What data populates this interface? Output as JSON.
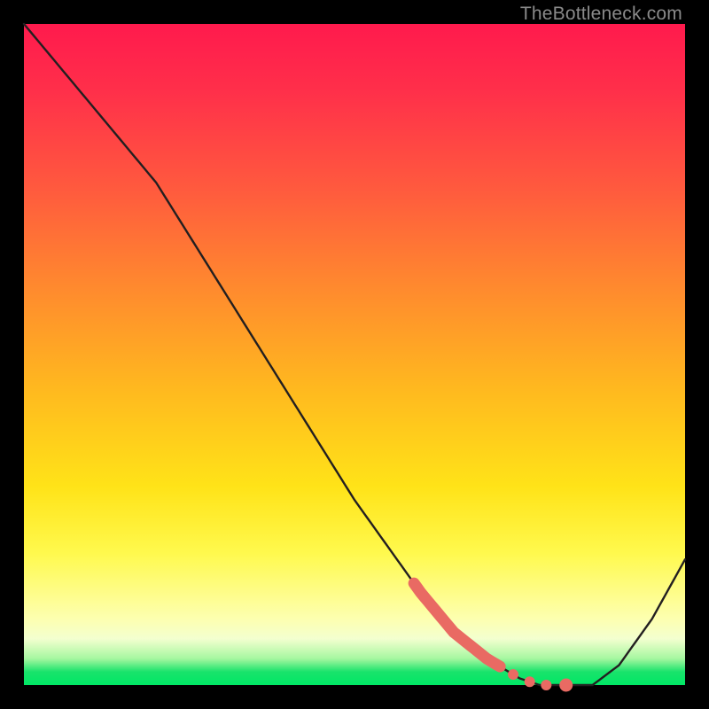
{
  "watermark": "TheBottleneck.com",
  "colors": {
    "background": "#000000",
    "curve": "#231f20",
    "highlight": "#e96a63",
    "gradient_top": "#ff1a4d",
    "gradient_bottom": "#00e765"
  },
  "chart_data": {
    "type": "line",
    "title": "",
    "xlabel": "",
    "ylabel": "",
    "xlim": [
      0,
      100
    ],
    "ylim": [
      0,
      100
    ],
    "x": [
      0,
      5,
      10,
      15,
      20,
      25,
      30,
      35,
      40,
      45,
      50,
      55,
      60,
      65,
      70,
      75,
      78,
      80,
      83,
      86,
      90,
      95,
      100
    ],
    "y": [
      100,
      94,
      88,
      82,
      76,
      68,
      60,
      52,
      44,
      36,
      28,
      21,
      14,
      8,
      4,
      1,
      0,
      0,
      0,
      0,
      3,
      10,
      19
    ],
    "highlight_segment": {
      "x_start": 59,
      "x_end": 72
    },
    "highlight_dots_x": [
      74,
      76.5,
      79,
      82
    ]
  }
}
